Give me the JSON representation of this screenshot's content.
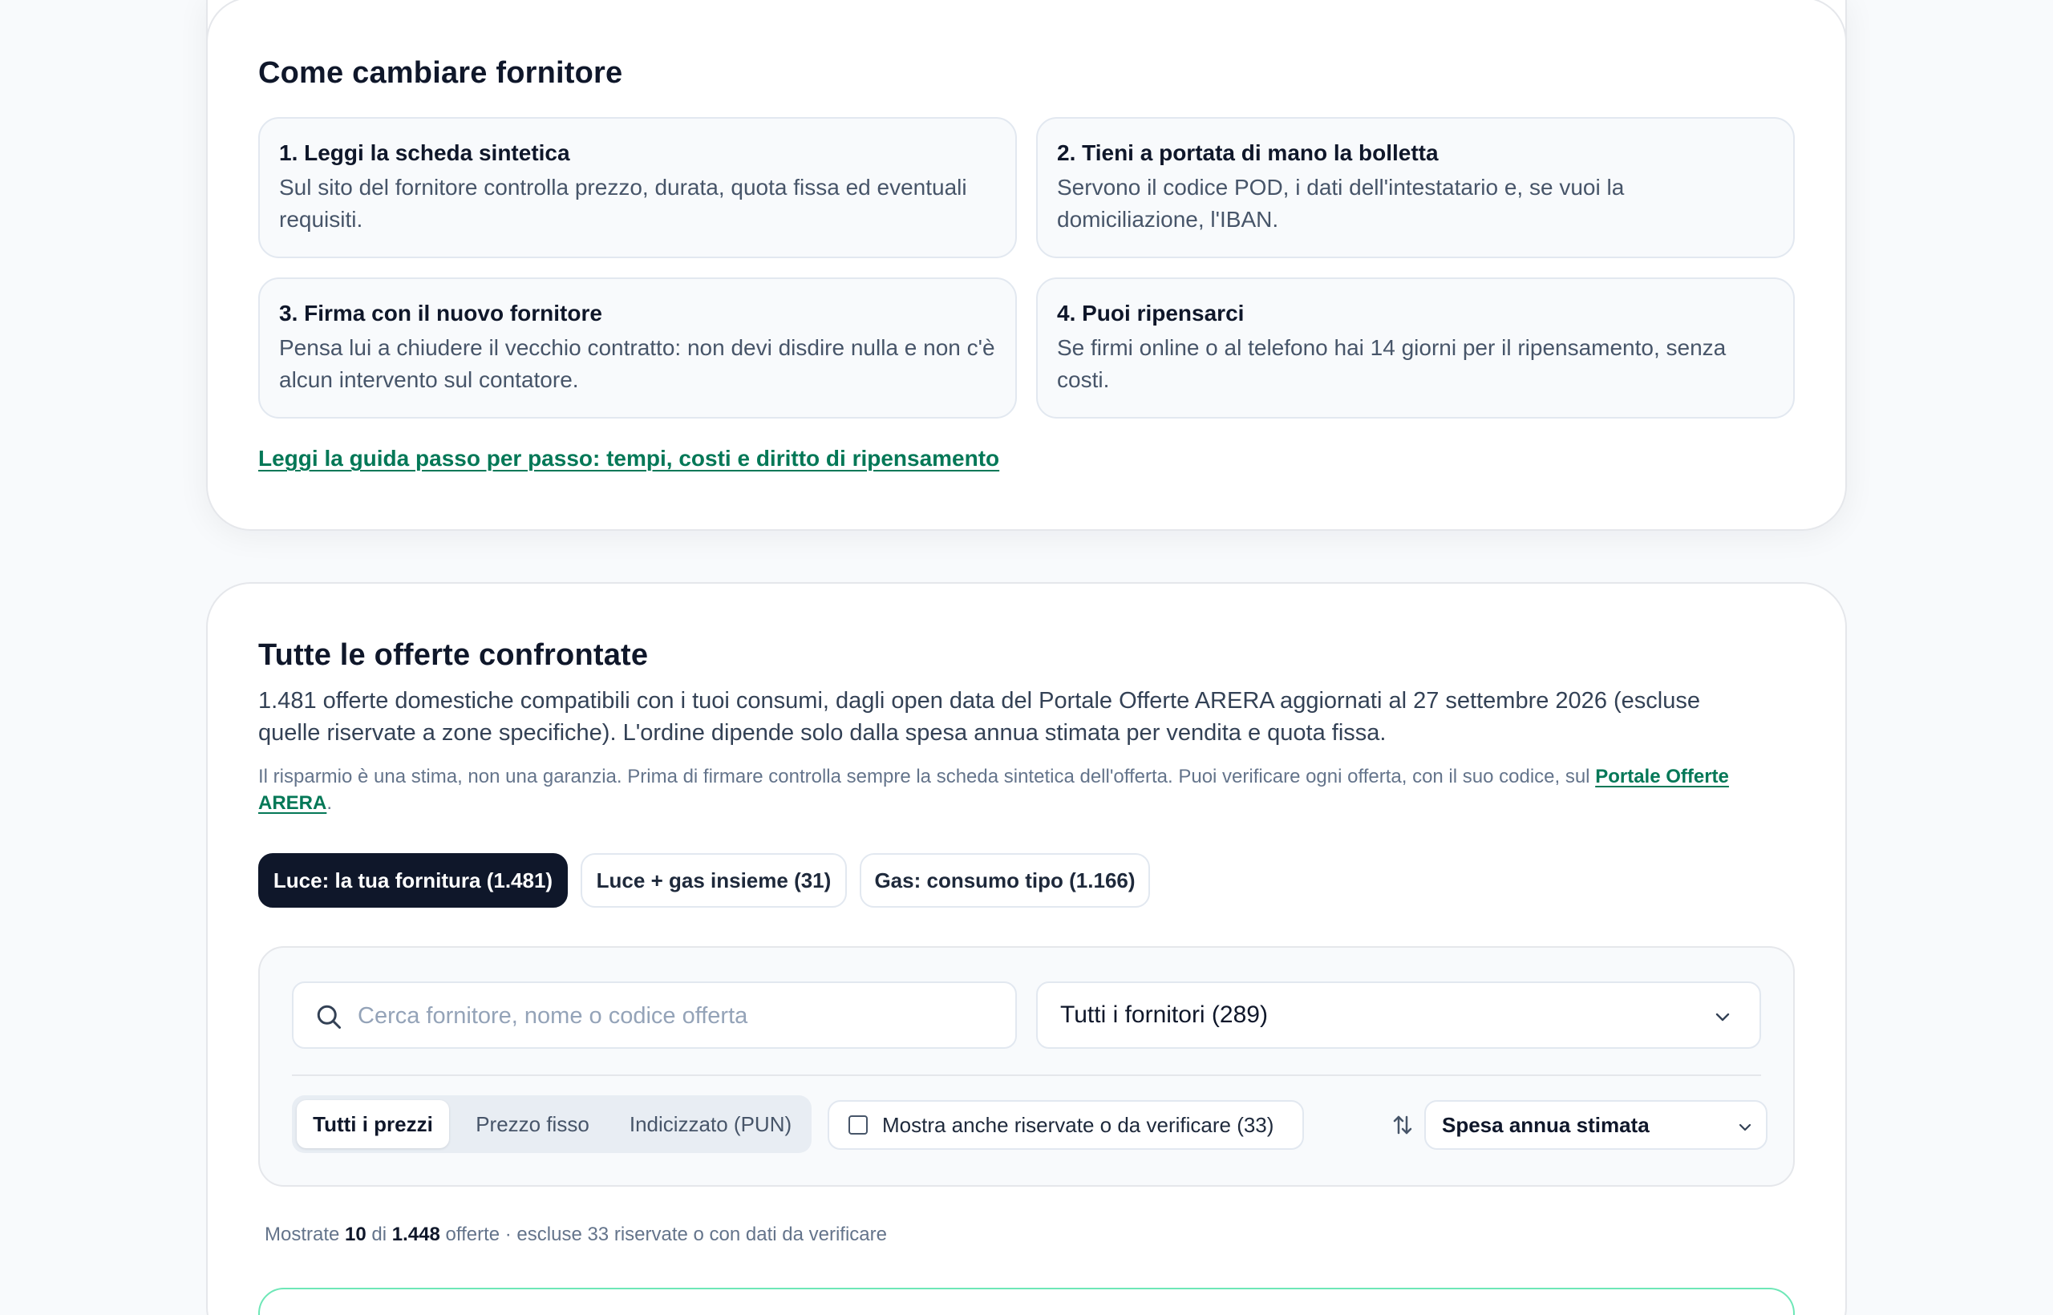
{
  "how_to": {
    "title": "Come cambiare fornitore",
    "steps": [
      {
        "title": "1. Leggi la scheda sintetica",
        "desc": "Sul sito del fornitore controlla prezzo, durata, quota fissa ed eventuali requisiti."
      },
      {
        "title": "2. Tieni a portata di mano la bolletta",
        "desc": "Servono il codice POD, i dati dell'intestatario e, se vuoi la domiciliazione, l'IBAN."
      },
      {
        "title": "3. Firma con il nuovo fornitore",
        "desc": "Pensa lui a chiudere il vecchio contratto: non devi disdire nulla e non c'è alcun intervento sul contatore."
      },
      {
        "title": "4. Puoi ripensarci",
        "desc": "Se firmi online o al telefono hai 14 giorni per il ripensamento, senza costi."
      }
    ],
    "guide_link": "Leggi la guida passo per passo: tempi, costi e diritto di ripensamento"
  },
  "offers": {
    "title": "Tutte le offerte confrontate",
    "lead": "1.481 offerte domestiche compatibili con i tuoi consumi, dagli open data del Portale Offerte ARERA aggiornati al 27 settembre 2026 (escluse quelle riservate a zone specifiche). L'ordine dipende solo dalla spesa annua stimata per vendita e quota fissa.",
    "note_text": "Il risparmio è una stima, non una garanzia. Prima di firmare controlla sempre la scheda sintetica dell'offerta. Puoi verificare ogni offerta, con il suo codice, sul ",
    "note_link": "Portale Offerte ARERA",
    "note_end": ".",
    "tabs": [
      {
        "label": "Luce: la tua fornitura (1.481)",
        "active": true
      },
      {
        "label": "Luce + gas insieme (31)",
        "active": false
      },
      {
        "label": "Gas: consumo tipo (1.166)",
        "active": false
      }
    ],
    "search": {
      "placeholder": "Cerca fornitore, nome o codice offerta",
      "value": ""
    },
    "supplier_select": "Tutti i fornitori (289)",
    "price_types": [
      {
        "label": "Tutti i prezzi",
        "active": true
      },
      {
        "label": "Prezzo fisso",
        "active": false
      },
      {
        "label": "Indicizzato (PUN)",
        "active": false
      }
    ],
    "show_reserved": {
      "label": "Mostra anche riservate o da verificare (33)",
      "checked": false
    },
    "sort": "Spesa annua stimata",
    "count": {
      "pre": "Mostrate ",
      "shown": "10",
      "mid": " di ",
      "total": "1.448",
      "post": " offerte · escluse 33 riservate o con dati da verificare"
    }
  },
  "colors": {
    "accent": "#047857",
    "dark": "#0f172a",
    "offer_border": "#6ee7b7"
  },
  "icons": {
    "search": "search-icon",
    "chevron": "chevron-down-icon",
    "sort": "sort-arrows-icon"
  }
}
